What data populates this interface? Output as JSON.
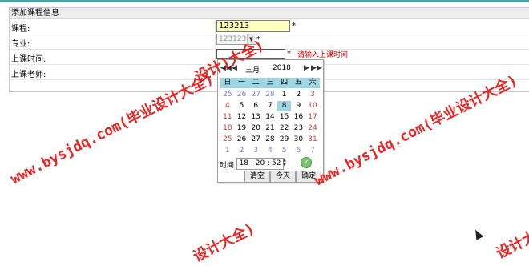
{
  "panel": {
    "title": "添加课程信息"
  },
  "form": {
    "course_label": "课程:",
    "course_value": "123213",
    "major_label": "专业:",
    "major_value": "123123",
    "time_label": "上课时间:",
    "time_value": "",
    "teacher_label": "上课老师:",
    "required_mark": "*",
    "time_hint": "请输入上课时间"
  },
  "datepicker": {
    "nav_prev_year": "◀◀",
    "nav_prev_month": "◀",
    "month": "三月",
    "year": "2018",
    "nav_next_month": "▶",
    "nav_next_year": "▶▶",
    "weekdays": [
      "日",
      "一",
      "二",
      "三",
      "四",
      "五",
      "六"
    ],
    "weeks": [
      [
        "25",
        "26",
        "27",
        "28",
        "1",
        "2",
        "3"
      ],
      [
        "4",
        "5",
        "6",
        "7",
        "8",
        "9",
        "10"
      ],
      [
        "11",
        "12",
        "13",
        "14",
        "15",
        "16",
        "17"
      ],
      [
        "18",
        "19",
        "20",
        "21",
        "22",
        "23",
        "24"
      ],
      [
        "25",
        "26",
        "27",
        "28",
        "29",
        "30",
        "31"
      ],
      [
        "1",
        "2",
        "3",
        "4",
        "5",
        "6",
        "7"
      ]
    ],
    "selected_day": "8",
    "time_label": "时间",
    "time_value": "18 : 20 : 52",
    "clear_label": "清空",
    "today_label": "今天",
    "ok_label": "确定",
    "colors": {
      "header_bg": "#9ed7e3",
      "weekend": "#d23b3b",
      "other_month": "#7b7bd6"
    }
  },
  "watermarks": [
    "www.bysjdq.com(毕业设计大全)",
    "www.bysjdq.com(毕业设计大全)",
    "设计)大全)",
    "设计大全)",
    "设计大"
  ]
}
